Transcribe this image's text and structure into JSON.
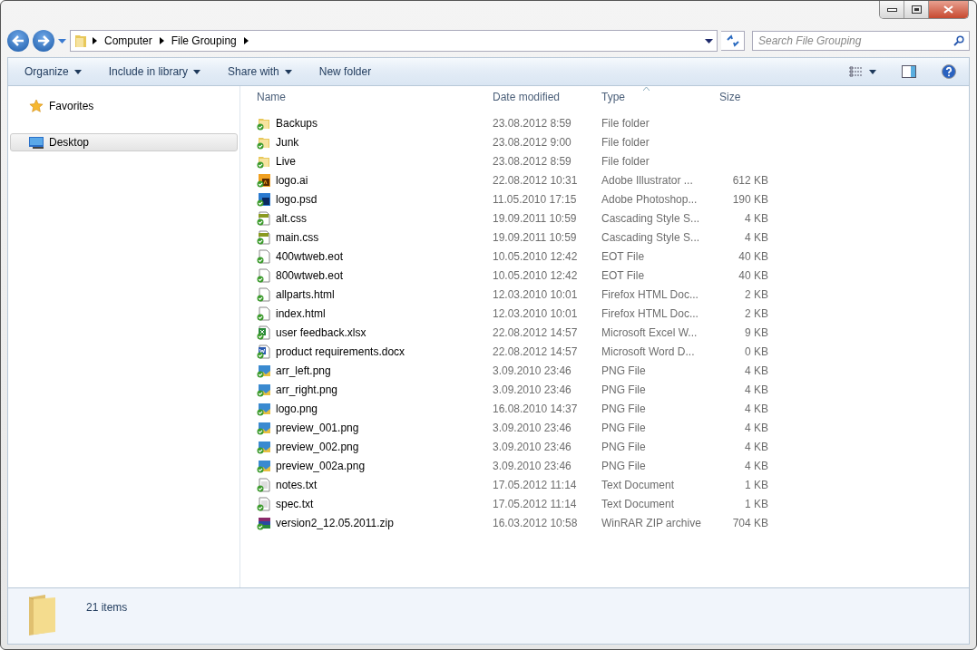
{
  "address": {
    "crumbs": [
      "Computer",
      "File Grouping"
    ]
  },
  "search": {
    "placeholder": "Search File Grouping"
  },
  "toolbar": {
    "buttons": [
      {
        "label": "Organize",
        "dropdown": true
      },
      {
        "label": "Include in library",
        "dropdown": true
      },
      {
        "label": "Share with",
        "dropdown": true
      },
      {
        "label": "New folder",
        "dropdown": false
      }
    ]
  },
  "sidebar": {
    "items": [
      {
        "label": "Favorites",
        "kind": "favorites",
        "selected": false
      },
      {
        "label": "Desktop",
        "kind": "desktop",
        "selected": true
      }
    ]
  },
  "table": {
    "columns": [
      {
        "label": "Name",
        "sorted": false
      },
      {
        "label": "Date modified",
        "sorted": false
      },
      {
        "label": "Type",
        "sorted": true
      },
      {
        "label": "Size",
        "sorted": false
      }
    ],
    "rows": [
      {
        "kind": "folder",
        "name": "Backups",
        "date": "23.08.2012 8:59",
        "type": "File folder"
      },
      {
        "kind": "folder",
        "name": "Junk",
        "date": "23.08.2012 9:00",
        "type": "File folder"
      },
      {
        "kind": "folder",
        "name": "Live",
        "date": "23.08.2012 8:59",
        "type": "File folder"
      },
      {
        "kind": "ai",
        "name": "logo.ai",
        "date": "22.08.2012 10:31",
        "type": "Adobe Illustrator ...",
        "size": "612 KB"
      },
      {
        "kind": "psd",
        "name": "logo.psd",
        "date": "11.05.2010 17:15",
        "type": "Adobe Photoshop...",
        "size": "190 KB"
      },
      {
        "kind": "css",
        "name": "alt.css",
        "date": "19.09.2011 10:59",
        "type": "Cascading Style S...",
        "size": "4 KB"
      },
      {
        "kind": "css",
        "name": "main.css",
        "date": "19.09.2011 10:59",
        "type": "Cascading Style S...",
        "size": "4 KB"
      },
      {
        "kind": "file",
        "name": "400wtweb.eot",
        "date": "10.05.2010 12:42",
        "type": "EOT File",
        "size": "40 KB"
      },
      {
        "kind": "file",
        "name": "800wtweb.eot",
        "date": "10.05.2010 12:42",
        "type": "EOT File",
        "size": "40 KB"
      },
      {
        "kind": "file",
        "name": "allparts.html",
        "date": "12.03.2010 10:01",
        "type": "Firefox HTML Doc...",
        "size": "2 KB"
      },
      {
        "kind": "file",
        "name": "index.html",
        "date": "12.03.2010 10:01",
        "type": "Firefox HTML Doc...",
        "size": "2 KB"
      },
      {
        "kind": "xlsx",
        "name": "user feedback.xlsx",
        "date": "22.08.2012 14:57",
        "type": "Microsoft Excel W...",
        "size": "9 KB"
      },
      {
        "kind": "docx",
        "name": "product requirements.docx",
        "date": "22.08.2012 14:57",
        "type": "Microsoft Word D...",
        "size": "0 KB"
      },
      {
        "kind": "png",
        "name": "arr_left.png",
        "date": "3.09.2010 23:46",
        "type": "PNG File",
        "size": "4 KB"
      },
      {
        "kind": "png",
        "name": "arr_right.png",
        "date": "3.09.2010 23:46",
        "type": "PNG File",
        "size": "4 KB"
      },
      {
        "kind": "png",
        "name": "logo.png",
        "date": "16.08.2010 14:37",
        "type": "PNG File",
        "size": "4 KB"
      },
      {
        "kind": "png",
        "name": "preview_001.png",
        "date": "3.09.2010 23:46",
        "type": "PNG File",
        "size": "4 KB"
      },
      {
        "kind": "png",
        "name": "preview_002.png",
        "date": "3.09.2010 23:46",
        "type": "PNG File",
        "size": "4 KB"
      },
      {
        "kind": "png",
        "name": "preview_002a.png",
        "date": "3.09.2010 23:46",
        "type": "PNG File",
        "size": "4 KB"
      },
      {
        "kind": "txt",
        "name": "notes.txt",
        "date": "17.05.2012 11:14",
        "type": "Text Document",
        "size": "1 KB"
      },
      {
        "kind": "txt",
        "name": "spec.txt",
        "date": "17.05.2012 11:14",
        "type": "Text Document",
        "size": "1 KB"
      },
      {
        "kind": "zip",
        "name": "version2_12.05.2011.zip",
        "date": "16.03.2012 10:58",
        "type": "WinRAR ZIP archive",
        "size": "704 KB"
      }
    ]
  },
  "status_bar": {
    "count": "21 items"
  }
}
